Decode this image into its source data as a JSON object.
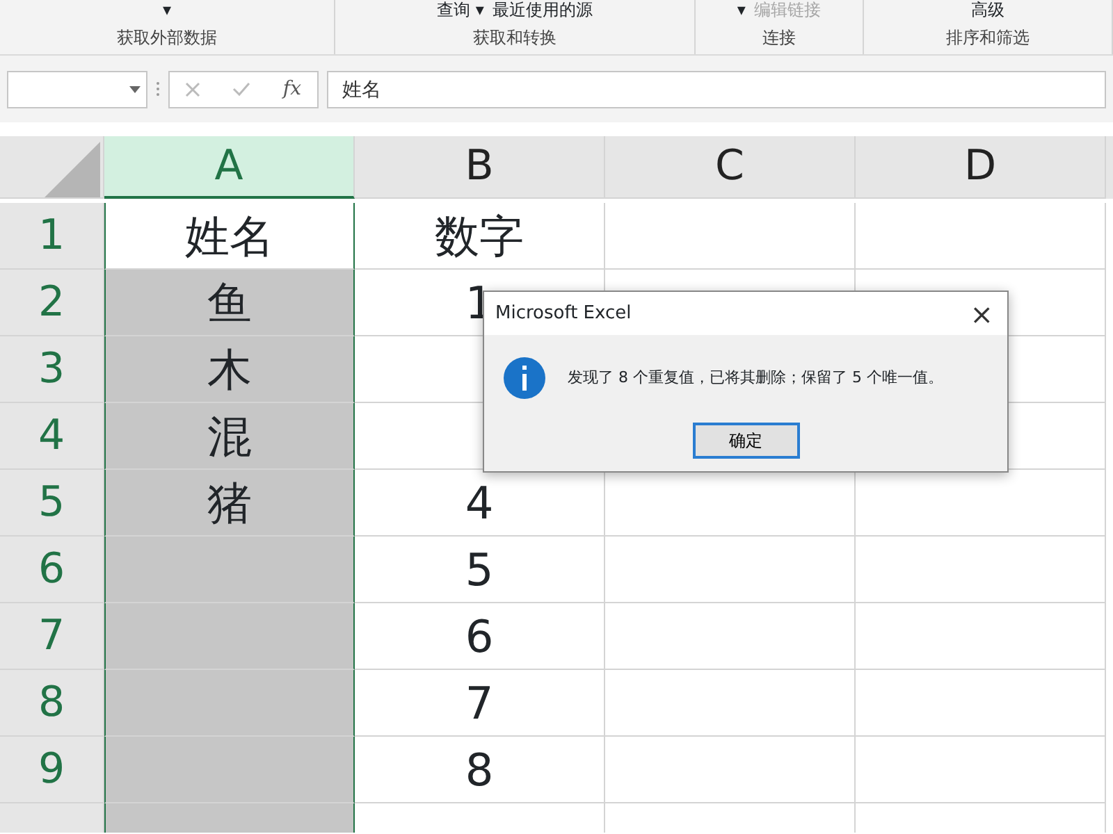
{
  "ribbon": {
    "groups": [
      {
        "label": "获取外部数据",
        "items": [
          {
            "text": "▾",
            "disabled": false
          }
        ]
      },
      {
        "label": "获取和转换",
        "items": [
          {
            "text": "查询 ▾",
            "disabled": false
          },
          {
            "text": "最近使用的源",
            "disabled": false
          }
        ]
      },
      {
        "label": "连接",
        "items": [
          {
            "text": "▾",
            "disabled": false
          },
          {
            "text": "编辑链接",
            "disabled": true
          }
        ]
      },
      {
        "label": "排序和筛选",
        "items": [
          {
            "text": "高级",
            "disabled": false
          }
        ]
      }
    ]
  },
  "formula_bar": {
    "fx": "fx",
    "value": "姓名"
  },
  "columns": [
    {
      "label": "A",
      "selected": true
    },
    {
      "label": "B",
      "selected": false
    },
    {
      "label": "C",
      "selected": false
    },
    {
      "label": "D",
      "selected": false
    }
  ],
  "rows": [
    {
      "header": "1",
      "cells": [
        {
          "text": "姓名",
          "active": true
        },
        {
          "text": "数字",
          "active": false
        }
      ]
    },
    {
      "header": "2",
      "cells": [
        {
          "text": "鱼",
          "active": false
        },
        {
          "text": "1",
          "active": false
        }
      ]
    },
    {
      "header": "3",
      "cells": [
        {
          "text": "木",
          "active": false
        },
        {
          "active": false
        }
      ]
    },
    {
      "header": "4",
      "cells": [
        {
          "text": "混",
          "active": false
        },
        {
          "active": false
        }
      ]
    },
    {
      "header": "5",
      "cells": [
        {
          "text": "猪",
          "active": false
        },
        {
          "text": "4",
          "active": false
        }
      ]
    },
    {
      "header": "6",
      "cells": [
        {
          "active": false
        },
        {
          "text": "5",
          "active": false
        }
      ]
    },
    {
      "header": "7",
      "cells": [
        {
          "active": false
        },
        {
          "text": "6",
          "active": false
        }
      ]
    },
    {
      "header": "8",
      "cells": [
        {
          "active": false
        },
        {
          "text": "7",
          "active": false
        }
      ]
    },
    {
      "header": "9",
      "cells": [
        {
          "active": false
        },
        {
          "text": "8",
          "active": false
        }
      ]
    },
    {
      "cells": [
        {
          "active": false
        },
        {
          "active": false
        }
      ]
    }
  ],
  "dialog": {
    "title": "Microsoft Excel",
    "close": "×",
    "message": "发现了 8 个重复值，已将其删除；保留了 5 个唯一值。",
    "button": "确定"
  }
}
